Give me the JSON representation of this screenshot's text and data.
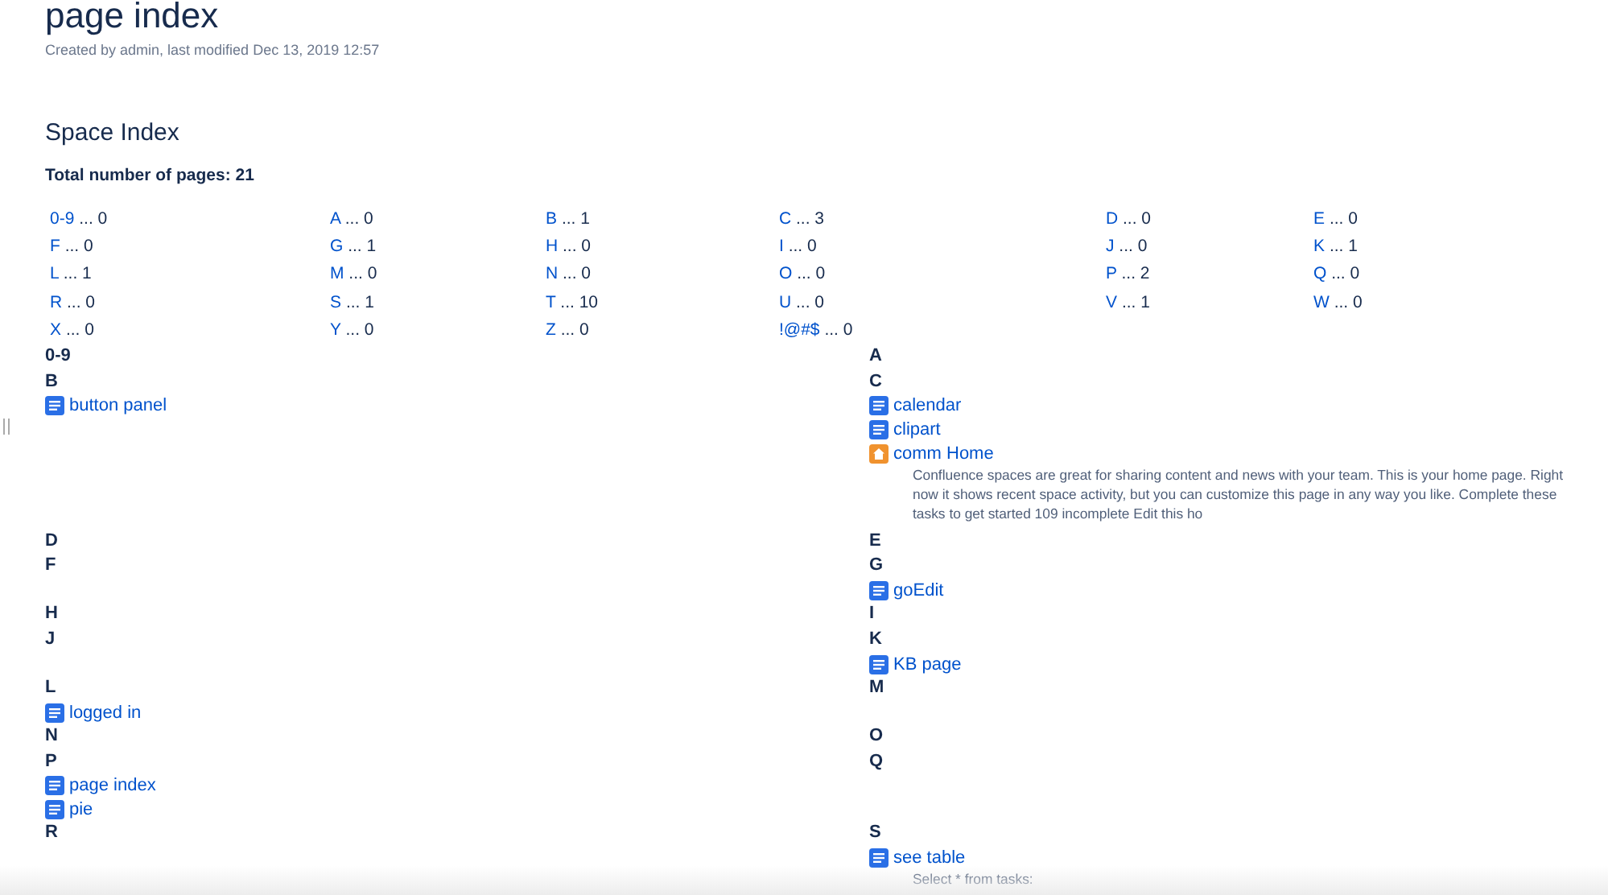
{
  "page": {
    "title": "page index",
    "meta": "Created by admin, last modified Dec 13, 2019 12:57"
  },
  "space_index": {
    "heading": "Space Index",
    "total": "Total number of pages: 21",
    "letter_counts": [
      {
        "letter": "0-9",
        "count": "... 0"
      },
      {
        "letter": "A",
        "count": "... 0"
      },
      {
        "letter": "B",
        "count": "... 1"
      },
      {
        "letter": "C",
        "count": "... 3"
      },
      {
        "letter": "D",
        "count": "... 0"
      },
      {
        "letter": "E",
        "count": "... 0"
      },
      {
        "letter": "F",
        "count": "... 0"
      },
      {
        "letter": "G",
        "count": "... 1"
      },
      {
        "letter": "H",
        "count": "... 0"
      },
      {
        "letter": "I",
        "count": "... 0"
      },
      {
        "letter": "J",
        "count": "... 0"
      },
      {
        "letter": "K",
        "count": "... 1"
      },
      {
        "letter": "L",
        "count": "... 1"
      },
      {
        "letter": "M",
        "count": "... 0"
      },
      {
        "letter": "N",
        "count": "... 0"
      },
      {
        "letter": "O",
        "count": "... 0"
      },
      {
        "letter": "P",
        "count": "... 2"
      },
      {
        "letter": "Q",
        "count": "... 0"
      },
      {
        "letter": "R",
        "count": "... 0"
      },
      {
        "letter": "S",
        "count": "... 1"
      },
      {
        "letter": "T",
        "count": "... 10"
      },
      {
        "letter": "U",
        "count": "... 0"
      },
      {
        "letter": "V",
        "count": "... 1"
      },
      {
        "letter": "W",
        "count": "... 0"
      },
      {
        "letter": "X",
        "count": "... 0"
      },
      {
        "letter": "Y",
        "count": "... 0"
      },
      {
        "letter": "Z",
        "count": "... 0"
      },
      {
        "letter": "!@#$",
        "count": "... 0"
      }
    ],
    "sections": [
      {
        "letter": "0-9"
      },
      {
        "letter": "A"
      },
      {
        "letter": "B",
        "pages": [
          {
            "kind": "page",
            "title": "button panel"
          }
        ]
      },
      {
        "letter": "C",
        "pages": [
          {
            "kind": "page",
            "title": "calendar"
          },
          {
            "kind": "page",
            "title": "clipart"
          },
          {
            "kind": "home",
            "title": "comm Home",
            "excerpt": "Confluence spaces are great for sharing content and news with your team. This is your home page. Right now it shows recent space activity, but you can customize this page in any way you like. Complete these tasks to get started 109 incomplete Edit this ho"
          }
        ]
      },
      {
        "letter": "D"
      },
      {
        "letter": "E"
      },
      {
        "letter": "F"
      },
      {
        "letter": "G",
        "pages": [
          {
            "kind": "page",
            "title": "goEdit"
          }
        ]
      },
      {
        "letter": "H"
      },
      {
        "letter": "I"
      },
      {
        "letter": "J"
      },
      {
        "letter": "K",
        "pages": [
          {
            "kind": "page",
            "title": "KB page"
          }
        ]
      },
      {
        "letter": "L",
        "pages": [
          {
            "kind": "page",
            "title": "logged in"
          }
        ]
      },
      {
        "letter": "M"
      },
      {
        "letter": "N"
      },
      {
        "letter": "O"
      },
      {
        "letter": "P",
        "pages": [
          {
            "kind": "page",
            "title": "page index"
          },
          {
            "kind": "page",
            "title": "pie"
          }
        ]
      },
      {
        "letter": "Q"
      },
      {
        "letter": "R"
      },
      {
        "letter": "S",
        "pages": [
          {
            "kind": "page",
            "title": "see table",
            "excerpt": "Select * from tasks:"
          }
        ]
      }
    ]
  }
}
